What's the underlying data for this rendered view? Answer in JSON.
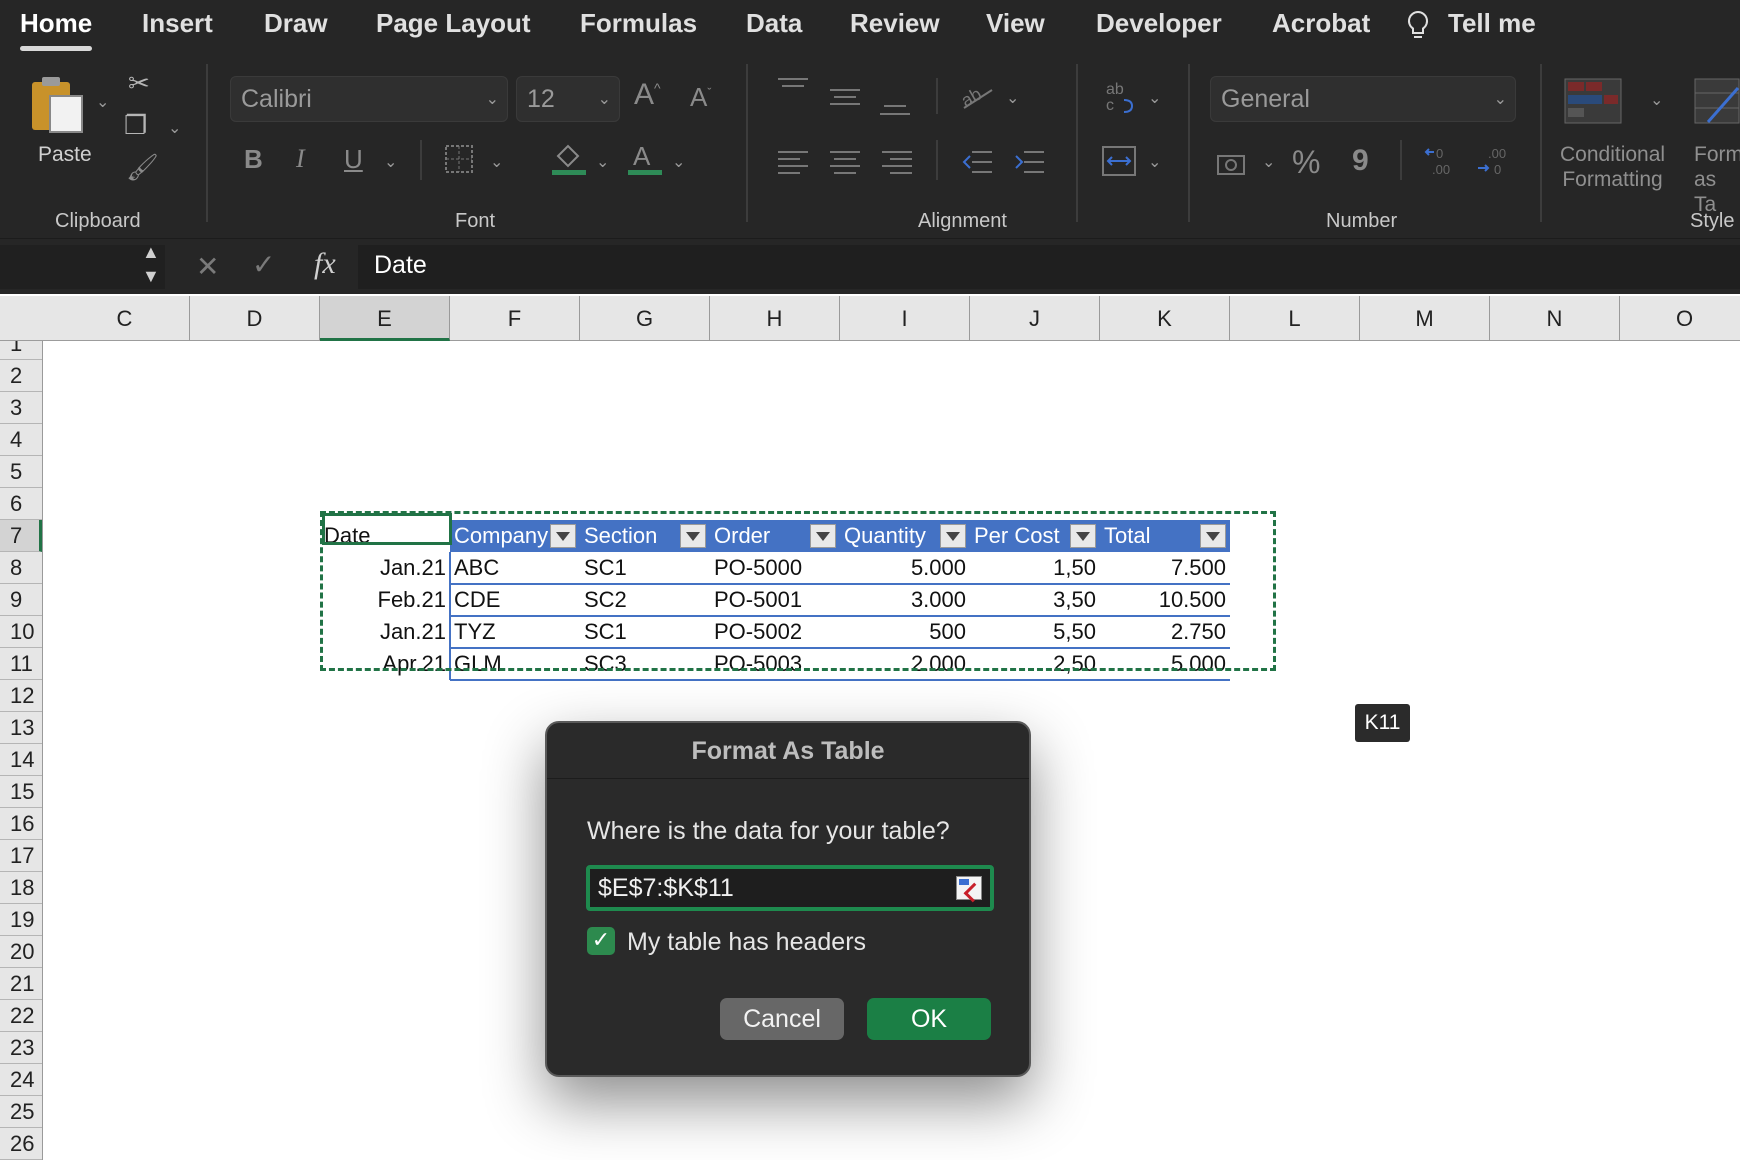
{
  "ribbon": {
    "tabs": [
      "Home",
      "Insert",
      "Draw",
      "Page Layout",
      "Formulas",
      "Data",
      "Review",
      "View",
      "Developer",
      "Acrobat",
      "Tell me"
    ],
    "clipboard": {
      "paste_label": "Paste",
      "group_label": "Clipboard"
    },
    "font": {
      "name": "Calibri",
      "size": "12",
      "group_label": "Font",
      "bold": "B",
      "italic": "I",
      "underline": "U"
    },
    "alignment": {
      "group_label": "Alignment"
    },
    "number": {
      "format": "General",
      "group_label": "Number",
      "percent": "%",
      "comma": "9"
    },
    "styles": {
      "conditional_formatting": "Conditional\nFormatting",
      "format_as_table": "Form\nas Ta",
      "group_label": "Style"
    }
  },
  "formula_bar": {
    "fx": "fx",
    "value": "Date"
  },
  "sheet": {
    "columns": [
      "C",
      "D",
      "E",
      "F",
      "G",
      "H",
      "I",
      "J",
      "K",
      "L",
      "M",
      "N",
      "O"
    ],
    "selected_column": "E",
    "rows": [
      "1",
      "2",
      "3",
      "4",
      "5",
      "6",
      "7",
      "8",
      "9",
      "10",
      "11",
      "12",
      "13",
      "14",
      "15",
      "16",
      "17",
      "18",
      "19",
      "20",
      "21",
      "22",
      "23",
      "24",
      "25",
      "26"
    ],
    "selected_row": "7",
    "table": {
      "headers": [
        "Date",
        "Company",
        "Section",
        "Order",
        "Quantity",
        "Per Cost",
        "Total"
      ],
      "rows": [
        [
          "Jan.21",
          "ABC",
          "SC1",
          "PO-5000",
          "5.000",
          "1,50",
          "7.500"
        ],
        [
          "Feb.21",
          "CDE",
          "SC2",
          "PO-5001",
          "3.000",
          "3,50",
          "10.500"
        ],
        [
          "Jan.21",
          "TYZ",
          "SC1",
          "PO-5002",
          "500",
          "5,50",
          "2.750"
        ],
        [
          "Apr.21",
          "GLM",
          "SC3",
          "PO-5003",
          "2.000",
          "2,50",
          "5.000"
        ]
      ]
    },
    "cell_tooltip": "K11"
  },
  "dialog": {
    "title": "Format As Table",
    "question": "Where is the data for your table?",
    "range": "$E$7:$K$11",
    "headers_checkbox_label": "My table has headers",
    "headers_checked": true,
    "cancel_label": "Cancel",
    "ok_label": "OK"
  },
  "colors": {
    "accent": "#217346",
    "table_header": "#4472c4",
    "ok_button": "#1b7f45"
  }
}
